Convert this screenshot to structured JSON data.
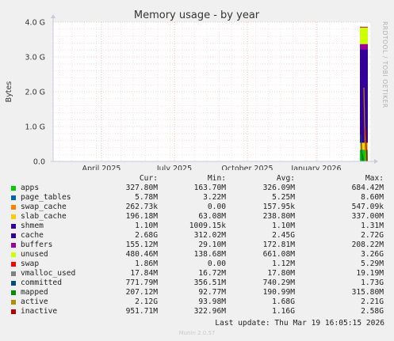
{
  "chart_data": {
    "type": "area",
    "title": "Memory usage - by year",
    "ylabel": "Bytes",
    "yticks": [
      "0.0",
      "1.0 G",
      "2.0 G",
      "3.0 G",
      "4.0 G"
    ],
    "ylim": [
      0,
      4.0
    ],
    "xticks": [
      "April 2025",
      "July 2025",
      "October 2025",
      "January 2026"
    ],
    "side_label": "RRDTOOL / TOBI OETIKER",
    "grid": true,
    "legend_placement": "bottom",
    "columns": [
      "Cur:",
      "Min:",
      "Avg:",
      "Max:"
    ],
    "series": [
      {
        "name": "apps",
        "color": "#00cc00",
        "cur": "327.80M",
        "min": "163.70M",
        "avg": "326.09M",
        "max": "684.42M",
        "value": 0.33
      },
      {
        "name": "page_tables",
        "color": "#0066b3",
        "cur": "5.78M",
        "min": "3.22M",
        "avg": "5.25M",
        "max": "8.60M",
        "value": 0.006
      },
      {
        "name": "swap_cache",
        "color": "#ff8000",
        "cur": "262.73k",
        "min": "0.00",
        "avg": "157.95k",
        "max": "547.09k",
        "value": 0.0003
      },
      {
        "name": "slab_cache",
        "color": "#ffcc00",
        "cur": "196.18M",
        "min": "63.08M",
        "avg": "238.80M",
        "max": "337.00M",
        "value": 0.2
      },
      {
        "name": "shmem",
        "color": "#330099",
        "cur": "1.10M",
        "min": "1009.15k",
        "avg": "1.10M",
        "max": "1.31M",
        "value": 0.001
      },
      {
        "name": "cache",
        "color": "#330099",
        "cur": "2.68G",
        "min": "312.02M",
        "avg": "2.45G",
        "max": "2.72G",
        "value": 2.68
      },
      {
        "name": "buffers",
        "color": "#990099",
        "cur": "155.12M",
        "min": "29.10M",
        "avg": "172.81M",
        "max": "208.22M",
        "value": 0.155
      },
      {
        "name": "unused",
        "color": "#ccff00",
        "cur": "480.46M",
        "min": "138.68M",
        "avg": "661.08M",
        "max": "3.26G",
        "value": 0.48
      },
      {
        "name": "swap",
        "color": "#ff0000",
        "cur": "1.86M",
        "min": "0.00",
        "avg": "1.12M",
        "max": "5.29M",
        "value": 0.002
      },
      {
        "name": "vmalloc_used",
        "color": "#808080",
        "cur": "17.84M",
        "min": "16.72M",
        "avg": "17.80M",
        "max": "19.19M",
        "value": 0.018
      },
      {
        "name": "committed",
        "color": "#004d80",
        "cur": "771.79M",
        "min": "356.51M",
        "avg": "740.29M",
        "max": "1.73G",
        "value": 0.77
      },
      {
        "name": "mapped",
        "color": "#008f00",
        "cur": "207.12M",
        "min": "92.77M",
        "avg": "190.99M",
        "max": "315.80M",
        "value": 0.21
      },
      {
        "name": "active",
        "color": "#b38f00",
        "cur": "2.12G",
        "min": "93.98M",
        "avg": "1.68G",
        "max": "2.21G",
        "value": 2.12
      },
      {
        "name": "inactive",
        "color": "#b30000",
        "cur": "951.71M",
        "min": "322.96M",
        "avg": "1.16G",
        "max": "2.58G",
        "value": 0.95
      }
    ]
  },
  "last_update": "Last update: Thu Mar 19 16:05:15 2026",
  "footer": "Munin 2.0.57"
}
